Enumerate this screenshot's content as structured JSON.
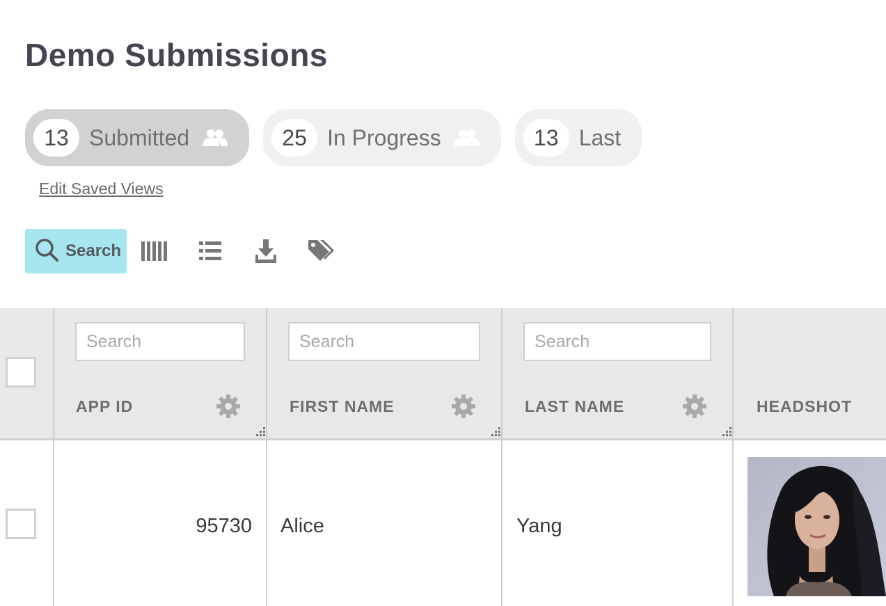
{
  "page": {
    "title": "Demo Submissions"
  },
  "saved_views": [
    {
      "count": "13",
      "label": "Submitted",
      "shared": true,
      "active": true
    },
    {
      "count": "25",
      "label": "In Progress",
      "shared": true,
      "active": false
    },
    {
      "count": "13",
      "label": "Last",
      "shared": false,
      "active": false
    }
  ],
  "edit_views_link": "Edit Saved Views",
  "toolbar": {
    "search_label": "Search",
    "icons": [
      "search-icon",
      "columns-icon",
      "list-icon",
      "download-icon",
      "tag-icon"
    ],
    "search_color": "#a7e6ef"
  },
  "table": {
    "columns": [
      {
        "label": "APP ID",
        "placeholder": "Search"
      },
      {
        "label": "FIRST NAME",
        "placeholder": "Search"
      },
      {
        "label": "LAST NAME",
        "placeholder": "Search"
      },
      {
        "label": "HEADSHOT"
      }
    ],
    "rows": [
      {
        "app_id": "95730",
        "first_name": "Alice",
        "last_name": "Yang",
        "headshot": "photo"
      }
    ]
  }
}
